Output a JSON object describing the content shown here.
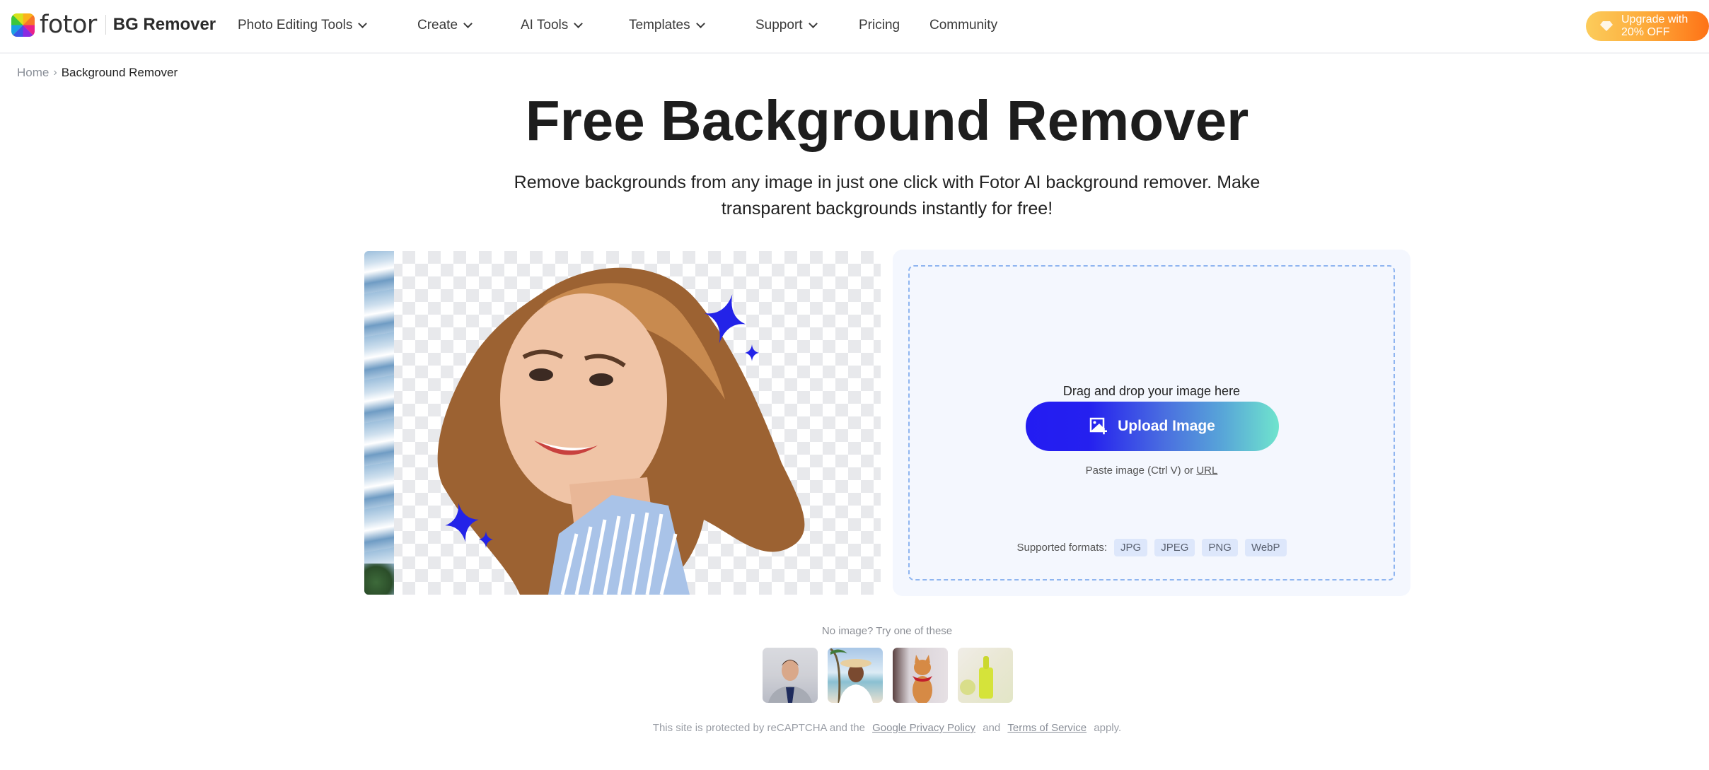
{
  "header": {
    "brand": "fotor",
    "product": "BG Remover",
    "nav": [
      {
        "label": "Photo Editing Tools",
        "has_dropdown": true
      },
      {
        "label": "Create",
        "has_dropdown": true
      },
      {
        "label": "AI Tools",
        "has_dropdown": true
      },
      {
        "label": "Templates",
        "has_dropdown": true
      },
      {
        "label": "Support",
        "has_dropdown": true
      },
      {
        "label": "Pricing",
        "has_dropdown": false
      },
      {
        "label": "Community",
        "has_dropdown": false
      }
    ],
    "upgrade": {
      "line1": "Upgrade with",
      "line2": "20% OFF",
      "icon": "diamond-icon"
    }
  },
  "breadcrumb": {
    "home": "Home",
    "separator": "›",
    "current": "Background Remover"
  },
  "hero": {
    "title": "Free Background Remover",
    "subtitle": "Remove backgrounds from any image in just one click with Fotor AI background remover. Make transparent backgrounds instantly for free!"
  },
  "example": {
    "description": "Smiling woman with wind-blown hair on transparent checkerboard background with blue sparkles",
    "sparkle_color": "#2323e8"
  },
  "upload": {
    "drag_text": "Drag and drop your image here",
    "button_label": "Upload Image",
    "button_icon": "add-image-icon",
    "paste_prefix": "Paste image (Ctrl V) or",
    "paste_link": "URL",
    "formats_label": "Supported formats:",
    "formats": [
      "JPG",
      "JPEG",
      "PNG",
      "WebP"
    ]
  },
  "samples": {
    "label": "No image? Try one of these",
    "items": [
      {
        "alt": "Man in grey suit with blue tie"
      },
      {
        "alt": "Woman in sun hat on beach"
      },
      {
        "alt": "Orange cat with red bandana"
      },
      {
        "alt": "Yellow-green product bottle"
      }
    ]
  },
  "recaptcha": {
    "prefix": "This site is protected by reCAPTCHA and the",
    "privacy_link": "Google Privacy Policy",
    "and": "and",
    "terms_link": "Terms of Service",
    "suffix": "apply."
  },
  "colors": {
    "upload_gradient_start": "#231cf2",
    "upload_gradient_end": "#6fe4cd",
    "upgrade_gradient_start": "#fccc5b",
    "upgrade_gradient_end": "#fe7216",
    "panel_bg": "#f4f7fe",
    "dash_border": "#8fb5f0"
  }
}
